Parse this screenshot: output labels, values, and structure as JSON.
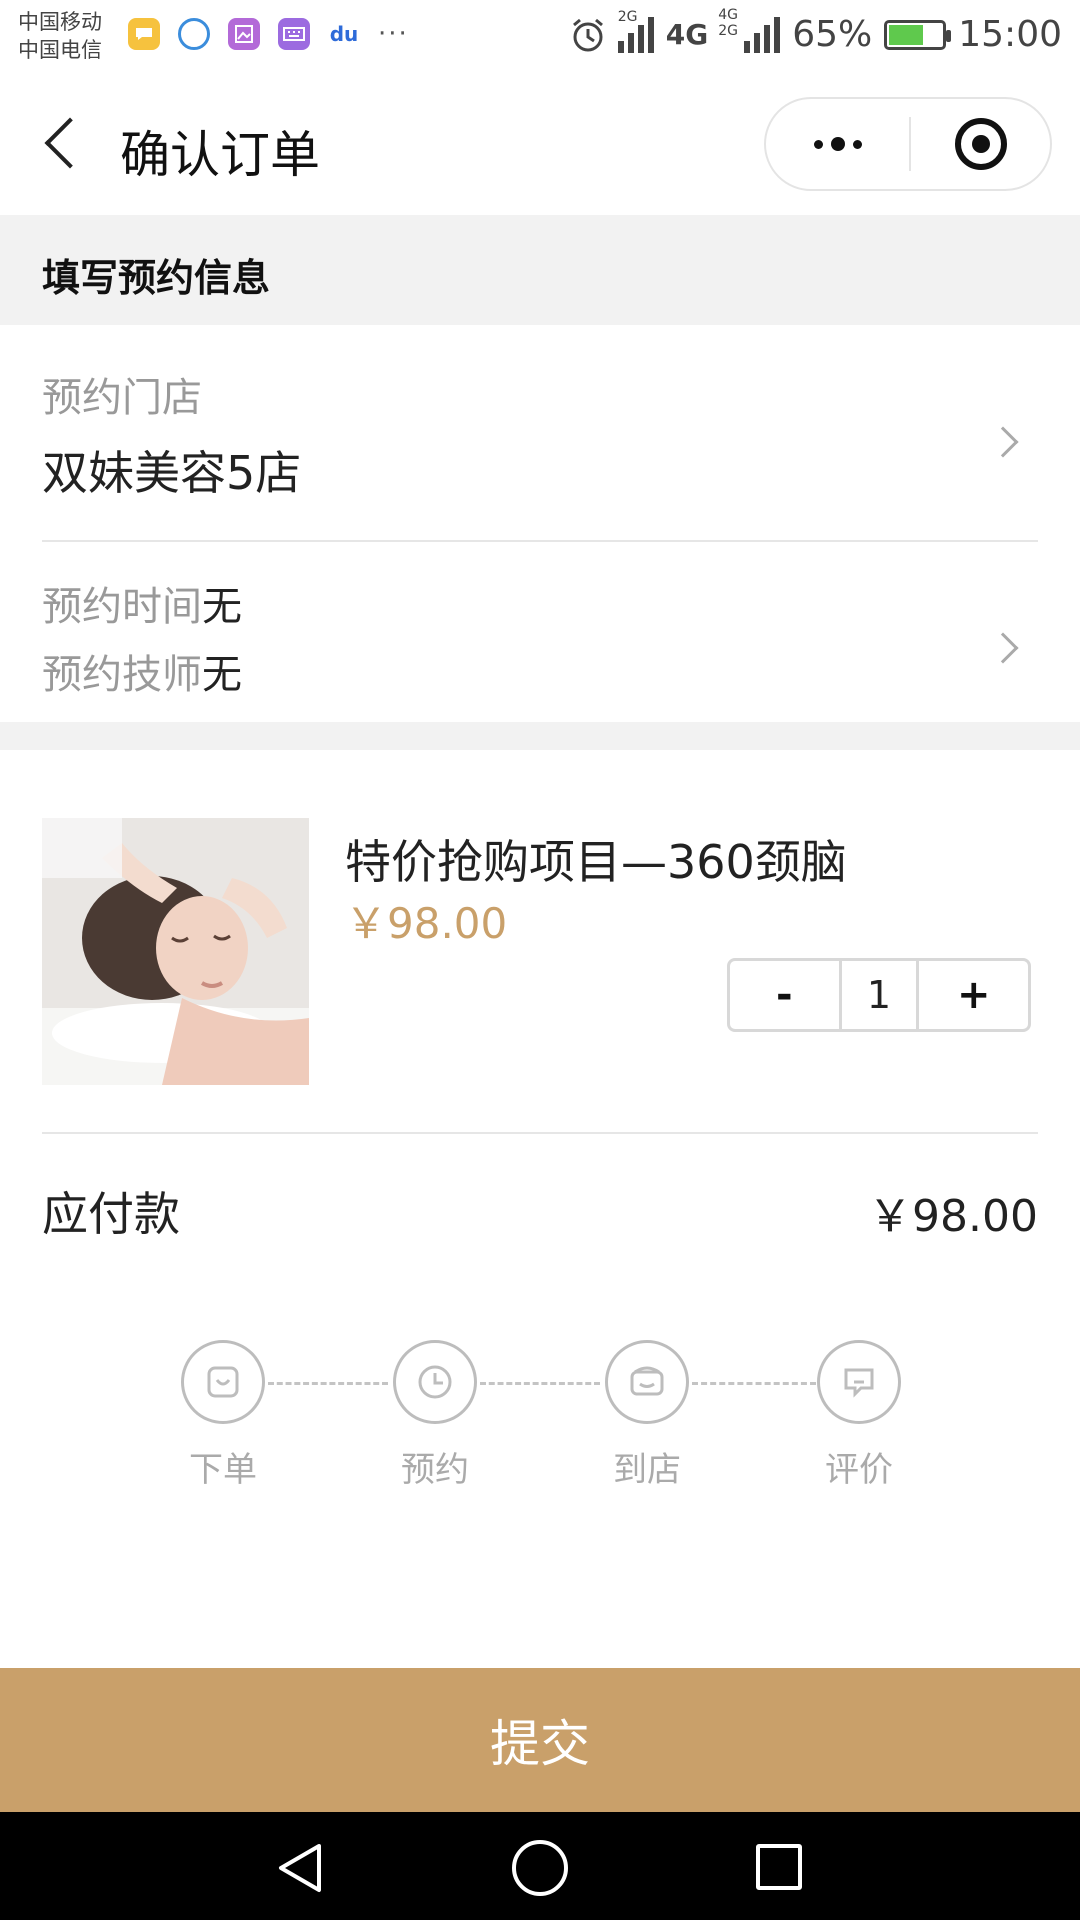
{
  "status_bar": {
    "carrier1": "中国移动",
    "carrier2": "中国电信",
    "app_icons": [
      "message-icon",
      "chat-icon",
      "gallery-icon",
      "keyboard-icon",
      "baidu-icon"
    ],
    "app_du": "du",
    "more": "···",
    "network1": "2G",
    "network2": "4G",
    "network3": "4G",
    "network4": "2G",
    "battery": "65%",
    "battery_level": 0.65,
    "time": "15:00"
  },
  "nav": {
    "title": "确认订单"
  },
  "section": {
    "title": "填写预约信息"
  },
  "store": {
    "label": "预约门店",
    "value": "双妹美容5店"
  },
  "booking": {
    "time_label": "预约时间",
    "time_value": "无",
    "tech_label": "预约技师",
    "tech_value": "无"
  },
  "product": {
    "name": "特价抢购项目—360颈脑",
    "price": "￥98.00",
    "minus": "-",
    "qty": "1",
    "plus": "+"
  },
  "payable": {
    "label": "应付款",
    "amount": "￥98.00"
  },
  "steps": [
    {
      "label": "下单",
      "icon": "bag-icon"
    },
    {
      "label": "预约",
      "icon": "clock-icon"
    },
    {
      "label": "到店",
      "icon": "store-icon"
    },
    {
      "label": "评价",
      "icon": "comment-icon"
    }
  ],
  "submit": {
    "label": "提交"
  },
  "colors": {
    "accent": "#c9a06a",
    "muted": "#999999",
    "section_bg": "#f2f2f2"
  }
}
